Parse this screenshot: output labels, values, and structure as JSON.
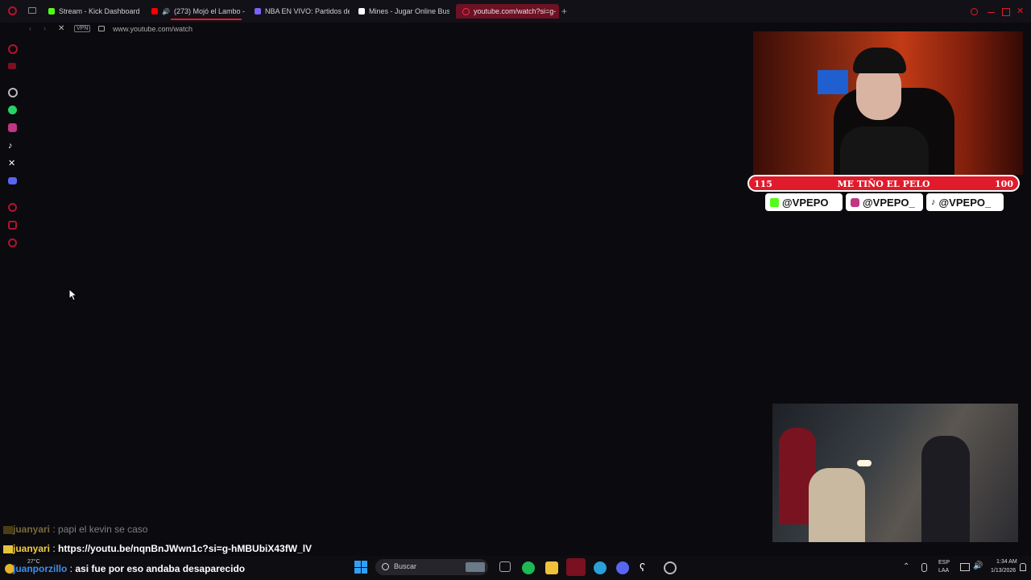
{
  "browser": {
    "tabs": [
      {
        "label": "Stream - Kick Dashboard",
        "color": "#53fc18"
      },
      {
        "label": "(273) Mojó el Lambo -",
        "color": "#ff0000"
      },
      {
        "label": "NBA EN VIVO: Partidos de",
        "color": "#7b61ff"
      },
      {
        "label": "Mines - Jugar Online Bus",
        "color": "#ffffff"
      },
      {
        "label": "youtube.com/watch?si=g-",
        "color": "#ff2d55"
      }
    ],
    "new_tab": "+",
    "vpn": "VPN",
    "url": "www.youtube.com/watch"
  },
  "overlay": {
    "goal": {
      "left": "115",
      "title": "ME TIÑO EL PELO",
      "right": "100"
    },
    "socials": [
      {
        "handle": "@VPEPO",
        "icon": "kick-icon"
      },
      {
        "handle": "@VPEPO_",
        "icon": "instagram-icon"
      },
      {
        "handle": "@VPEPO_",
        "icon": "tiktok-icon"
      }
    ]
  },
  "chat": [
    {
      "user": "juanyari",
      "sep": " : ",
      "text": "papi el kevin se caso"
    },
    {
      "user": "juanyari",
      "sep": " : ",
      "text": "https://youtu.be/nqnBnJWwn1c?si=g-hMBUbiX43fW_lV"
    },
    {
      "user": "juanporzillo",
      "sep": " : ",
      "text": "asi fue por eso andaba desaparecido"
    }
  ],
  "taskbar": {
    "weather": "27°C",
    "search": "Buscar",
    "lang1": "ESP",
    "lang2": "LAA",
    "time": "1:34 AM",
    "date": "1/13/2026"
  }
}
